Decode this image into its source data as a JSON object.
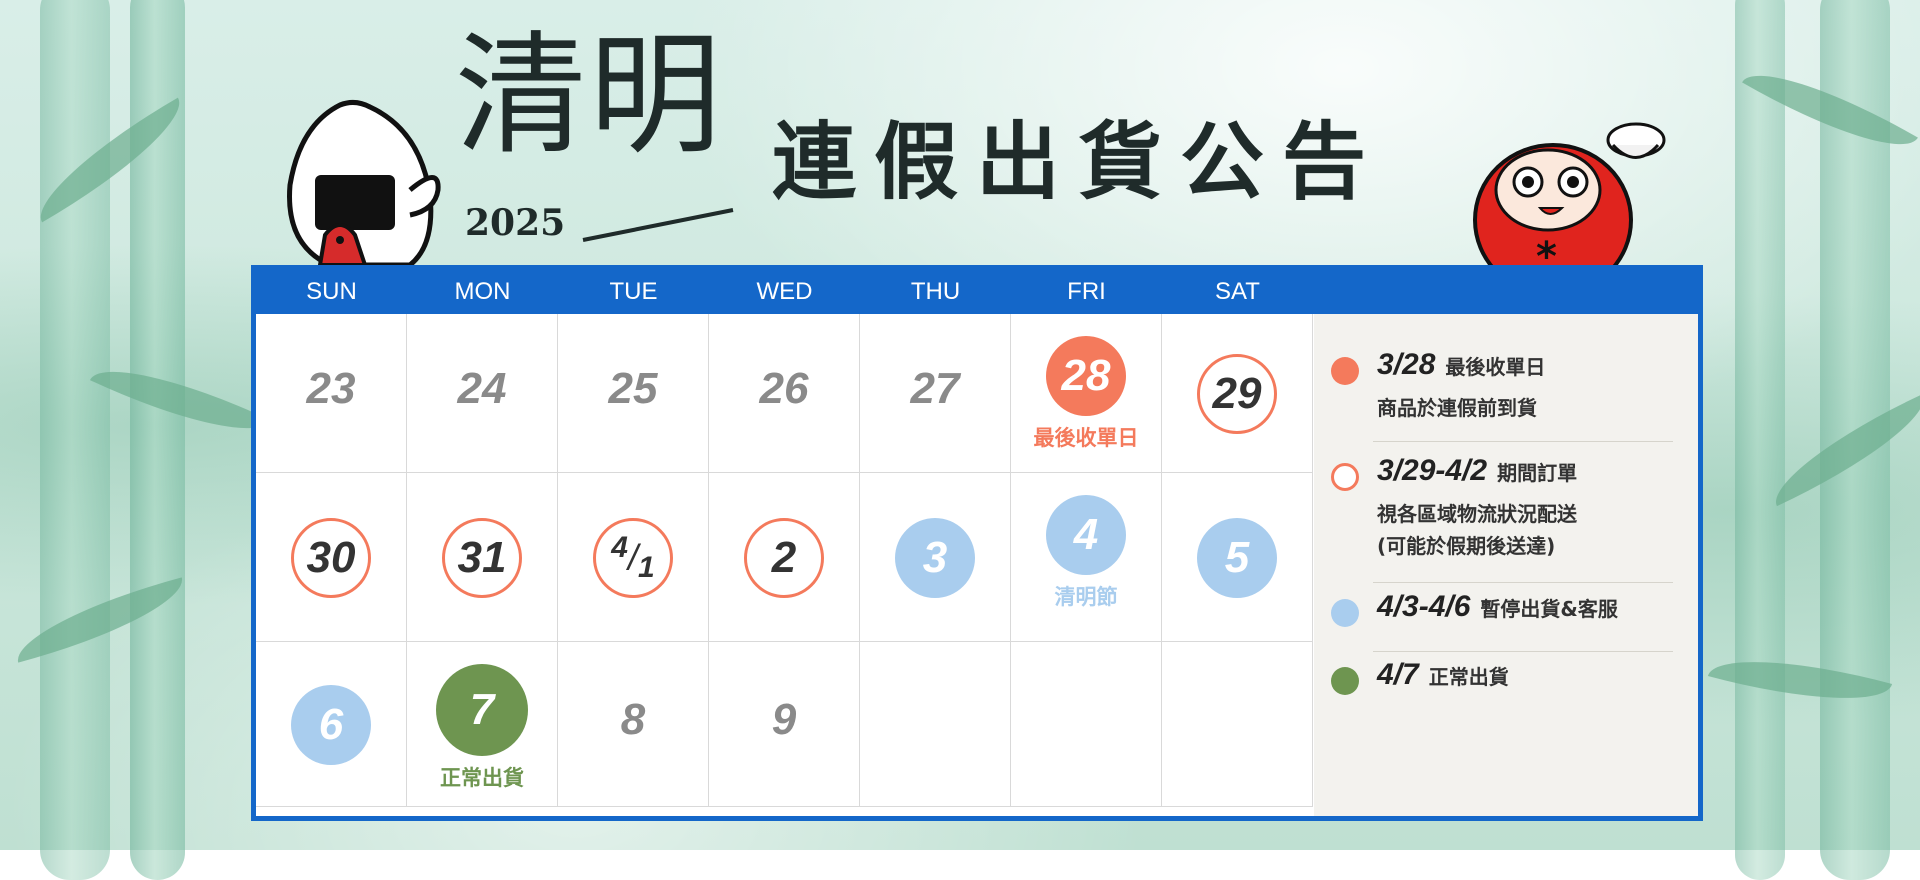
{
  "title": {
    "main": "清明",
    "year": "2025",
    "sub": "連假出貨公告"
  },
  "colors": {
    "accent_blue": "#1467c9",
    "orange": "#f47a5c",
    "light_blue": "#a9cdee",
    "green": "#6e9550",
    "grey_num": "#8a8a8a"
  },
  "weekdays": [
    "SUN",
    "MON",
    "TUE",
    "WED",
    "THU",
    "FRI",
    "SAT"
  ],
  "weeks": [
    [
      {
        "d": "23",
        "style": "plain"
      },
      {
        "d": "24",
        "style": "plain"
      },
      {
        "d": "25",
        "style": "plain"
      },
      {
        "d": "26",
        "style": "plain"
      },
      {
        "d": "27",
        "style": "plain"
      },
      {
        "d": "28",
        "style": "orange-fill",
        "note": "最後收單日"
      },
      {
        "d": "29",
        "style": "orange-ring"
      }
    ],
    [
      {
        "d": "30",
        "style": "orange-ring"
      },
      {
        "d": "31",
        "style": "orange-ring"
      },
      {
        "d": "4/1",
        "style": "orange-ring"
      },
      {
        "d": "2",
        "style": "orange-ring"
      },
      {
        "d": "3",
        "style": "blue-fill"
      },
      {
        "d": "4",
        "style": "blue-fill",
        "note": "清明節"
      },
      {
        "d": "5",
        "style": "blue-fill"
      }
    ],
    [
      {
        "d": "6",
        "style": "blue-fill"
      },
      {
        "d": "7",
        "style": "green-fill",
        "note": "正常出貨"
      },
      {
        "d": "8",
        "style": "plain"
      },
      {
        "d": "9",
        "style": "plain"
      }
    ]
  ],
  "legend": [
    {
      "dot": "orange-fill",
      "date": "3/28",
      "label": "最後收單日",
      "sub": [
        "商品於連假前到貨"
      ]
    },
    {
      "dot": "orange-ring",
      "date": "3/29-4/2",
      "label": "期間訂單",
      "sub": [
        "視各區域物流狀況配送",
        "(可能於假期後送達)"
      ]
    },
    {
      "dot": "blue-fill",
      "date": "4/3-4/6",
      "label": "暫停出貨&客服",
      "sub": []
    },
    {
      "dot": "green-fill",
      "date": "4/7",
      "label": "正常出貨",
      "sub": []
    }
  ]
}
